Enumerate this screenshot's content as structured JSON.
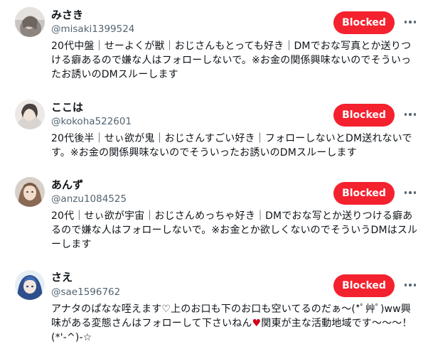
{
  "users": [
    {
      "name": "みさき",
      "handle": "@misaki1399524",
      "bio": "20代中盤｜せーよくが獣｜おじさんもとっても好き｜DMでおな写真とか送りつける癖あるので嫌な人はフォローしないで。※お金の関係興味ないのでそういったお誘いのDMスルーします",
      "button_label": "Blocked",
      "avatar_icon": "avatar-photo-icon"
    },
    {
      "name": "ここは",
      "handle": "@kokoha522601",
      "bio": "20代後半｜せぃ欲が鬼｜おじさんすごい好き｜フォローしないとDM送れないです。※お金の関係興味ないのでそういったお誘いのDMスルーします",
      "button_label": "Blocked",
      "avatar_icon": "avatar-photo-icon"
    },
    {
      "name": "あんず",
      "handle": "@anzu1084525",
      "bio": "20代｜せぃ欲が宇宙｜おじさんめっちゃ好き｜DMでおな写とか送りつける癖あるので嫌な人はフォローしないで。※お金とか欲しくないのでそういうDMはスルーします",
      "button_label": "Blocked",
      "avatar_icon": "avatar-photo-icon"
    },
    {
      "name": "さえ",
      "handle": "@sae1596762",
      "bio_before_heart": "アナタのぱなな咥えます♡上のお口も下のお口も空いてるのだぁ〜(*ﾟ艸ﾟ)ww興味がある変態さんはフォローして下さいねん",
      "heart": "♥",
      "bio_after_heart": "関東が主な活動地域です〜〜〜！(*'-^)-☆",
      "button_label": "Blocked",
      "avatar_icon": "avatar-illustration-icon"
    }
  ],
  "colors": {
    "blocked_button": "#f4212e",
    "handle_text": "#536471",
    "heart": "#d0021b"
  },
  "more_icon": "more-options-icon"
}
